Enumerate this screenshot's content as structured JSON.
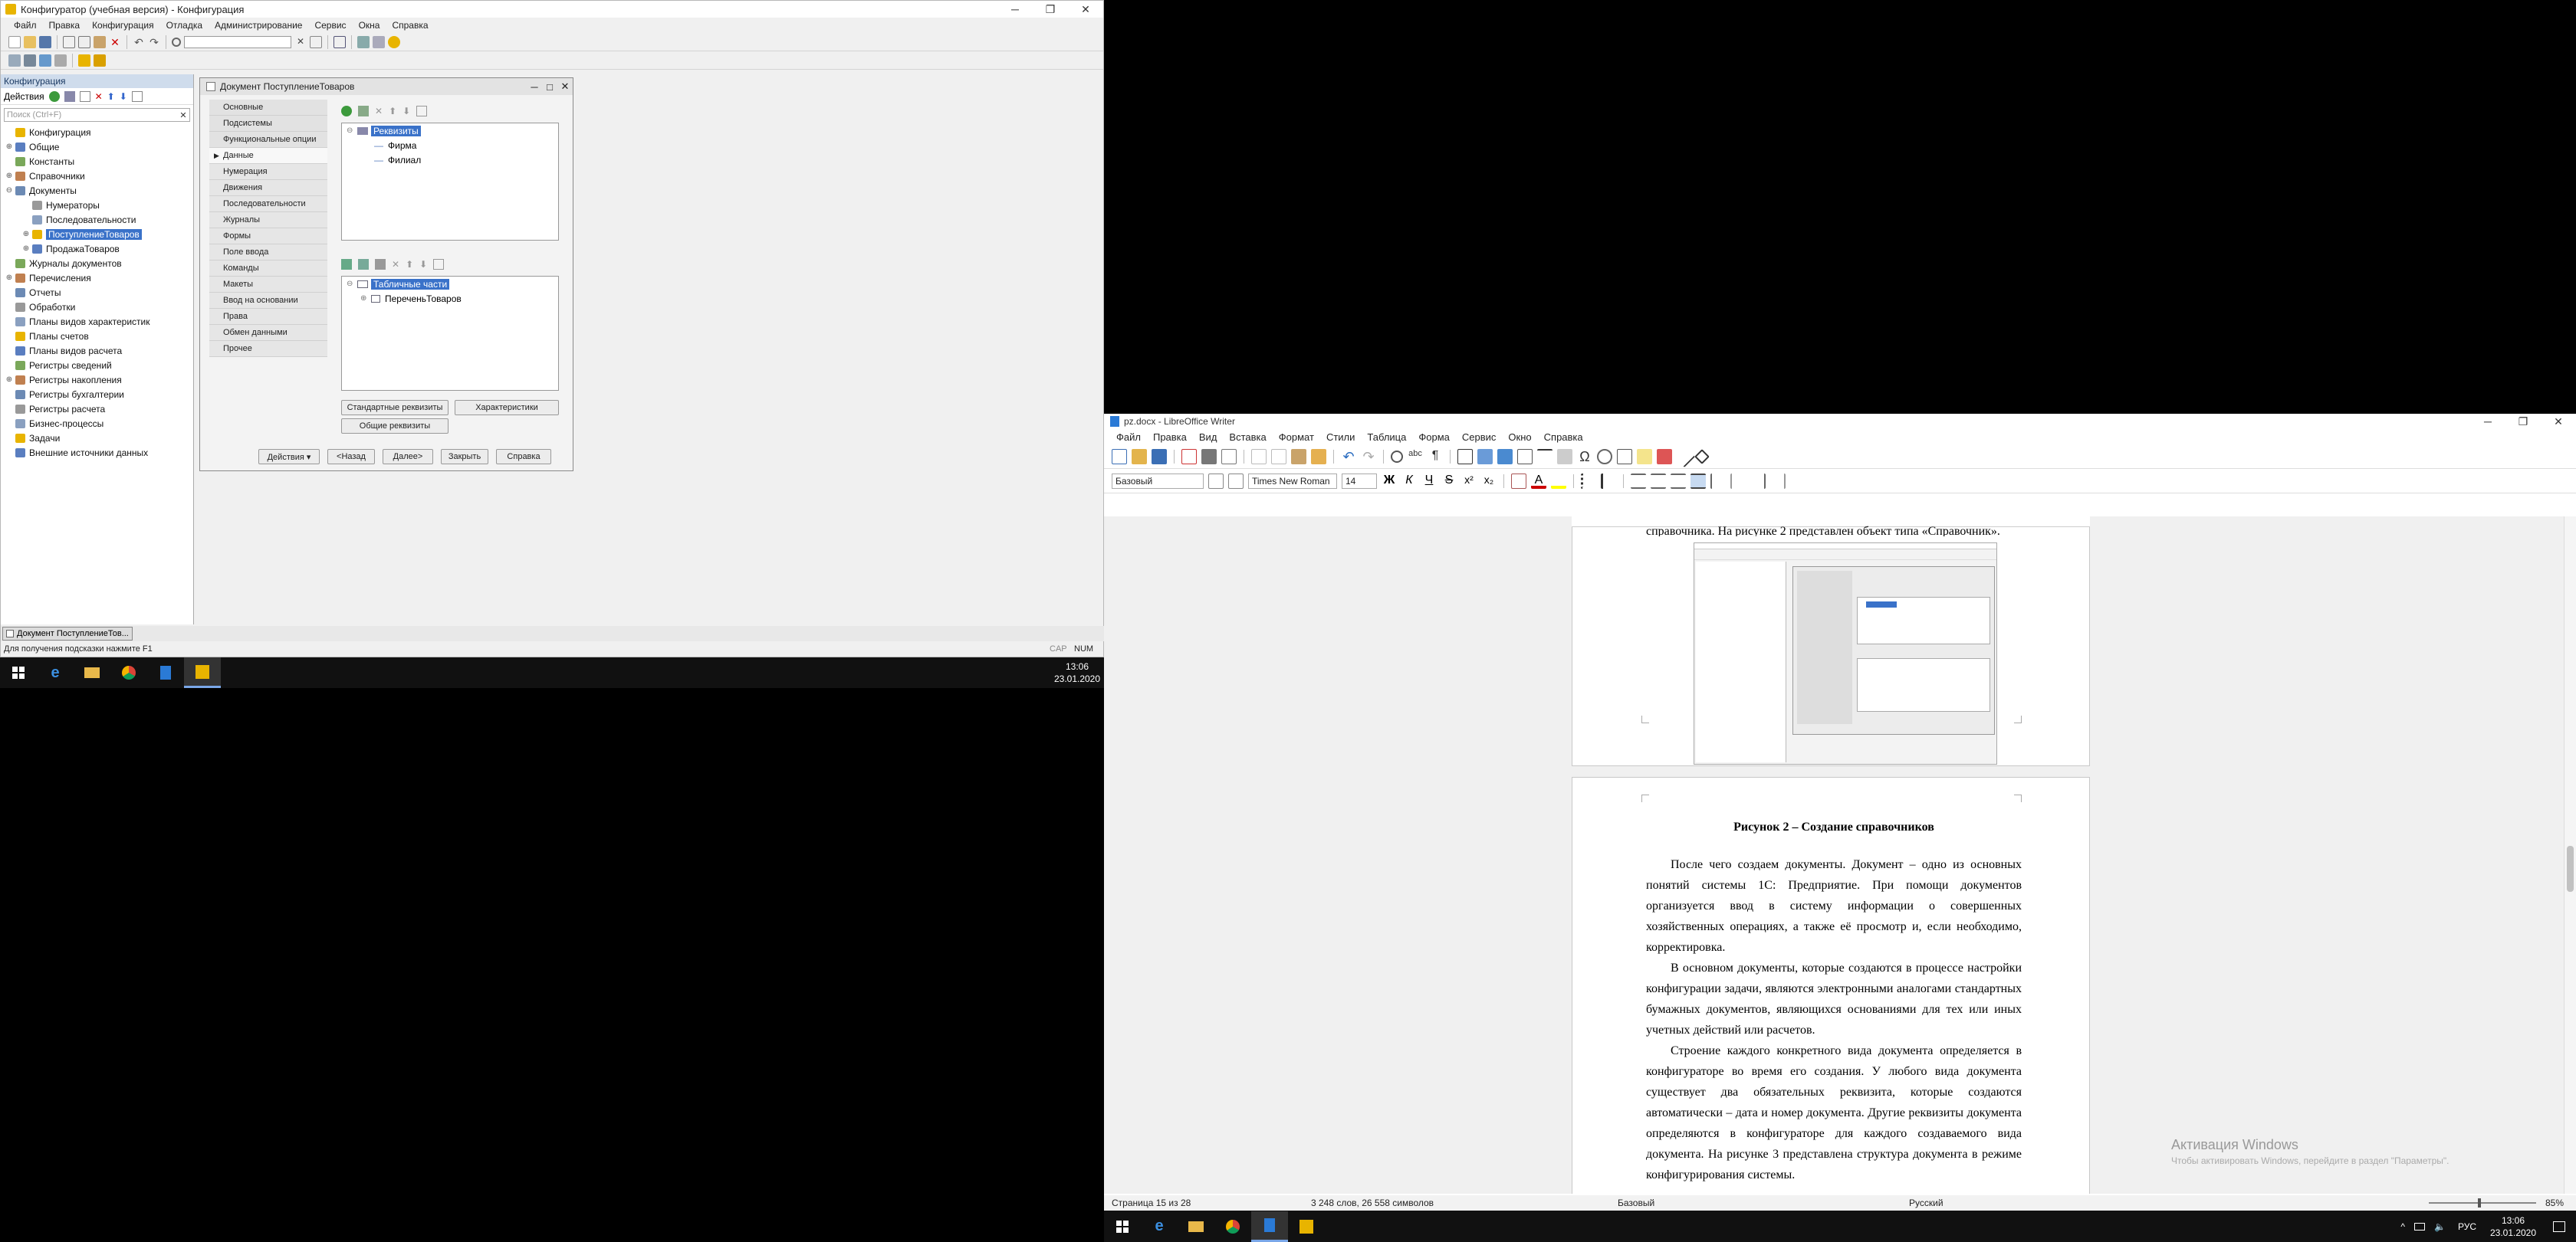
{
  "config1c": {
    "title": "Конфигуратор (учебная версия) - Конфигурация",
    "menu": [
      "Файл",
      "Правка",
      "Конфигурация",
      "Отладка",
      "Администрирование",
      "Сервис",
      "Окна",
      "Справка"
    ],
    "panel_title": "Конфигурация",
    "actions_label": "Действия",
    "search_placeholder": "Поиск (Ctrl+F)",
    "tree": [
      {
        "label": "Конфигурация",
        "level": 0,
        "exp": "",
        "sel": false
      },
      {
        "label": "Общие",
        "level": 0,
        "exp": "⊕",
        "sel": false
      },
      {
        "label": "Константы",
        "level": 0,
        "exp": "",
        "sel": false
      },
      {
        "label": "Справочники",
        "level": 0,
        "exp": "⊕",
        "sel": false
      },
      {
        "label": "Документы",
        "level": 0,
        "exp": "⊖",
        "sel": false
      },
      {
        "label": "Нумераторы",
        "level": 1,
        "exp": "",
        "sel": false
      },
      {
        "label": "Последовательности",
        "level": 1,
        "exp": "",
        "sel": false
      },
      {
        "label": "ПоступлениеТоваров",
        "level": 1,
        "exp": "⊕",
        "sel": true
      },
      {
        "label": "ПродажаТоваров",
        "level": 1,
        "exp": "⊕",
        "sel": false
      },
      {
        "label": "Журналы документов",
        "level": 0,
        "exp": "",
        "sel": false
      },
      {
        "label": "Перечисления",
        "level": 0,
        "exp": "⊕",
        "sel": false
      },
      {
        "label": "Отчеты",
        "level": 0,
        "exp": "",
        "sel": false
      },
      {
        "label": "Обработки",
        "level": 0,
        "exp": "",
        "sel": false
      },
      {
        "label": "Планы видов характеристик",
        "level": 0,
        "exp": "",
        "sel": false
      },
      {
        "label": "Планы счетов",
        "level": 0,
        "exp": "",
        "sel": false
      },
      {
        "label": "Планы видов расчета",
        "level": 0,
        "exp": "",
        "sel": false
      },
      {
        "label": "Регистры сведений",
        "level": 0,
        "exp": "",
        "sel": false
      },
      {
        "label": "Регистры накопления",
        "level": 0,
        "exp": "⊕",
        "sel": false
      },
      {
        "label": "Регистры бухгалтерии",
        "level": 0,
        "exp": "",
        "sel": false
      },
      {
        "label": "Регистры расчета",
        "level": 0,
        "exp": "",
        "sel": false
      },
      {
        "label": "Бизнес-процессы",
        "level": 0,
        "exp": "",
        "sel": false
      },
      {
        "label": "Задачи",
        "level": 0,
        "exp": "",
        "sel": false
      },
      {
        "label": "Внешние источники данных",
        "level": 0,
        "exp": "",
        "sel": false
      }
    ],
    "doc_window": {
      "title": "Документ ПоступлениеТоваров",
      "tabs_top": [
        "Основные",
        "Подсистемы",
        "Функциональные опции"
      ],
      "active_tab": "Данные",
      "tabs_bottom": [
        "Нумерация",
        "Движения",
        "Последовательности",
        "Журналы",
        "Формы",
        "Поле ввода",
        "Команды",
        "Макеты",
        "Ввод на основании",
        "Права",
        "Обмен данными",
        "Прочее"
      ],
      "attributes_root": "Реквизиты",
      "attributes": [
        "Фирма",
        "Филиал"
      ],
      "tables_root": "Табличные части",
      "tables": [
        "ПереченьТоваров"
      ],
      "btn_standard_attrs": "Стандартные реквизиты",
      "btn_characteristics": "Характеристики",
      "btn_common_attrs": "Общие реквизиты",
      "footer_buttons": [
        "Действия ▾",
        "<Назад",
        "Далее>",
        "Закрыть",
        "Справка"
      ]
    },
    "task_tab": "Документ ПоступлениеТов...",
    "status_hint": "Для получения подсказки нажмите F1",
    "status_cap": "CAP",
    "status_num": "NUM",
    "clock_time": "13:06",
    "clock_date": "23.01.2020"
  },
  "writer": {
    "title": "pz.docx - LibreOffice Writer",
    "menu": [
      "Файл",
      "Правка",
      "Вид",
      "Вставка",
      "Формат",
      "Стили",
      "Таблица",
      "Форма",
      "Сервис",
      "Окно",
      "Справка"
    ],
    "style_value": "Базовый",
    "font_value": "Times New Roman",
    "size_value": "14",
    "top_cut_text": "справочника. На рисунке 2 представлен объект типа «Справочник».",
    "caption": "Рисунок 2 – Создание справочников",
    "paragraphs": [
      "После чего создаем документы. Документ – одно из основных понятий системы 1С: Предприятие. При помощи документов организуется ввод в систему информации о совершенных хозяйственных операциях, а также её просмотр и, если необходимо, корректировка.",
      "В основном документы, которые создаются в процессе настройки конфигурации задачи, являются электронными аналогами стандартных бумажных документов, являющихся основаниями для тех или иных учетных действий или расчетов.",
      "Строение каждого конкретного вида документа определяется в конфигураторе во время его создания. У любого вида документа существует два обязательных реквизита, которые создаются автоматически – дата и номер документа. Другие реквизиты документа определяются в конфигураторе для каждого создаваемого вида документа. На рисунке 3 представлена структура документа в режиме конфигурирования системы."
    ],
    "watermark_title": "Активация Windows",
    "watermark_sub": "Чтобы активировать Windows, перейдите в раздел \"Параметры\".",
    "status_page": "Страница 15 из 28",
    "status_words": "3 248 слов, 26 558 символов",
    "status_style": "Базовый",
    "status_lang": "Русский",
    "zoom": "85%",
    "tray_lang": "РУС",
    "clock_time": "13:06",
    "clock_date": "23.01.2020"
  },
  "colors": {
    "selection": "#3a72c9",
    "accent_1c": "#e8b400",
    "taskbar": "#111111"
  }
}
